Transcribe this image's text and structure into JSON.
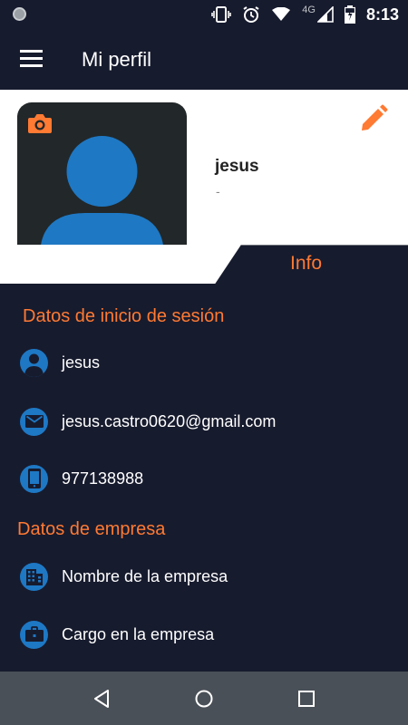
{
  "status_bar": {
    "network_label": "4G",
    "time": "8:13"
  },
  "app_bar": {
    "title": "Mi perfil",
    "menu_icon": "hamburger-menu-icon"
  },
  "profile": {
    "name": "jesus",
    "subtitle": "-",
    "camera_icon": "camera-icon",
    "edit_icon": "pencil-icon"
  },
  "tabs": {
    "active_label": "Info"
  },
  "login_section": {
    "title": "Datos de inicio de sesión",
    "items": [
      {
        "icon": "user-icon",
        "value": "jesus"
      },
      {
        "icon": "email-icon",
        "value": "jesus.castro0620@gmail.com"
      },
      {
        "icon": "phone-icon",
        "value": "977138988"
      }
    ]
  },
  "company_section": {
    "title": "Datos de empresa",
    "items": [
      {
        "icon": "building-icon",
        "value": "Nombre de la empresa"
      },
      {
        "icon": "briefcase-icon",
        "value": "Cargo en la empresa"
      }
    ]
  },
  "colors": {
    "background": "#171b2e",
    "accent": "#ff7a33",
    "icon_blue": "#1e78c4",
    "nav_bar": "#4a5057"
  }
}
